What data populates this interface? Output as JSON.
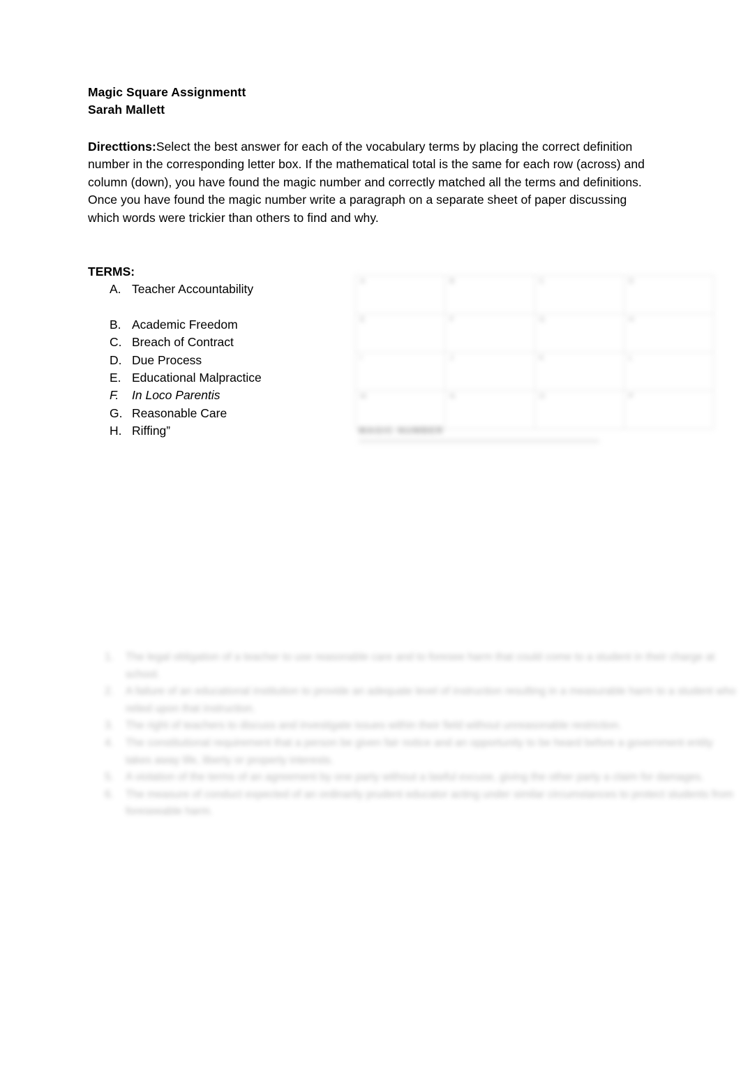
{
  "document": {
    "title": "Magic Square Assignmentt",
    "author": "Sarah Mallett"
  },
  "directions": {
    "label": "Directtions:",
    "paragraph1": "Select the best answer for each of the vocabulary terms by placing the correct definition number in the corresponding letter box. If the mathematical total is the same for each row (across) and column (down), you have found the magic number and correctly matched all the terms and definitions.",
    "paragraph2": "Once you have found the magic number write a paragraph on a separate sheet of paper discussing which words were trickier than others to find and why."
  },
  "terms": {
    "heading": "TERMS:",
    "items": [
      {
        "marker": "A.",
        "label": "Teacher Accountability",
        "italic": false,
        "gap_after": true
      },
      {
        "marker": "B.",
        "label": " Academic Freedom",
        "italic": false,
        "gap_after": false
      },
      {
        "marker": "C.",
        "label": "Breach of Contract",
        "italic": false,
        "gap_after": false
      },
      {
        "marker": "D.",
        "label": "Due Process",
        "italic": false,
        "gap_after": false
      },
      {
        "marker": "E.",
        "label": "Educational Malpractice",
        "italic": false,
        "gap_after": false
      },
      {
        "marker": "F.",
        "label": "In Loco Parentis",
        "italic": true,
        "gap_after": false
      },
      {
        "marker": "G.",
        "label": "Reasonable Care",
        "italic": false,
        "gap_after": false
      },
      {
        "marker": "H.",
        "label": "Riffing”",
        "italic": false,
        "gap_after": false
      }
    ]
  },
  "magic_square": {
    "legible": false,
    "rows": 4,
    "columns": 4,
    "cells": [
      [
        "",
        "",
        "",
        ""
      ],
      [
        "",
        "",
        "",
        ""
      ],
      [
        "",
        "",
        "",
        ""
      ],
      [
        "",
        "",
        "",
        ""
      ]
    ],
    "caption": ""
  },
  "definitions": {
    "legible": false,
    "items": [
      {
        "marker": "",
        "lines": [
          "",
          ""
        ]
      },
      {
        "marker": "",
        "lines": [
          "",
          ""
        ]
      },
      {
        "marker": "",
        "lines": [
          ""
        ]
      },
      {
        "marker": "",
        "lines": [
          "",
          "",
          ""
        ]
      },
      {
        "marker": "",
        "lines": [
          "",
          ""
        ]
      },
      {
        "marker": "",
        "lines": [
          "",
          ""
        ]
      }
    ]
  },
  "colors": {
    "page_background": "#ffffff",
    "text": "#000000",
    "blurred_text": "#5a5a5a",
    "table_border": "#cfcfcf"
  }
}
